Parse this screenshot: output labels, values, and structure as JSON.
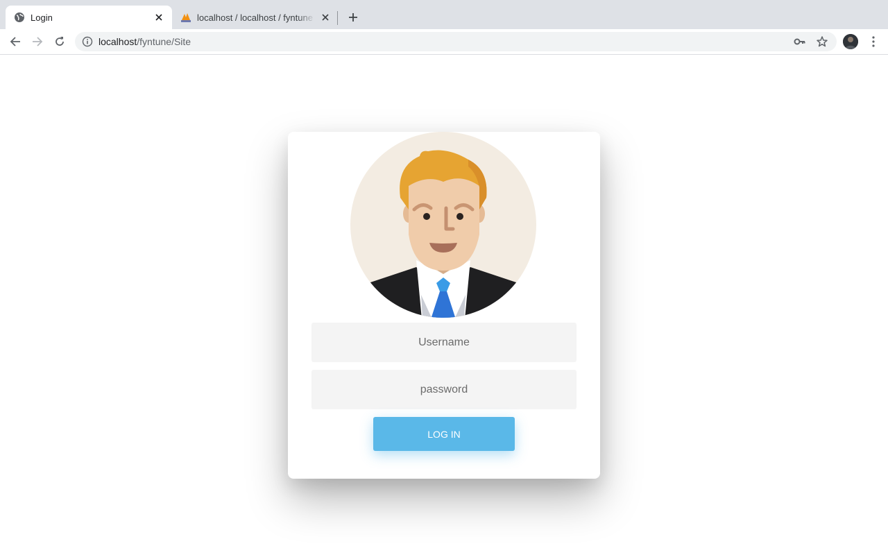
{
  "browser": {
    "tabs": [
      {
        "title": "Login",
        "icon": "globe-icon",
        "active": true
      },
      {
        "title": "localhost / localhost / fyntune / ",
        "icon": "phpmyadmin-icon",
        "active": false
      }
    ],
    "address_bar": {
      "host": "localhost",
      "path": "/fyntune/Site"
    }
  },
  "login_form": {
    "username_placeholder": "Username",
    "password_placeholder": "password",
    "submit_label": "LOG IN"
  },
  "colors": {
    "button": "#5ab8e8",
    "input_background": "#f4f4f4",
    "avatar_background": "#f3ece2"
  }
}
